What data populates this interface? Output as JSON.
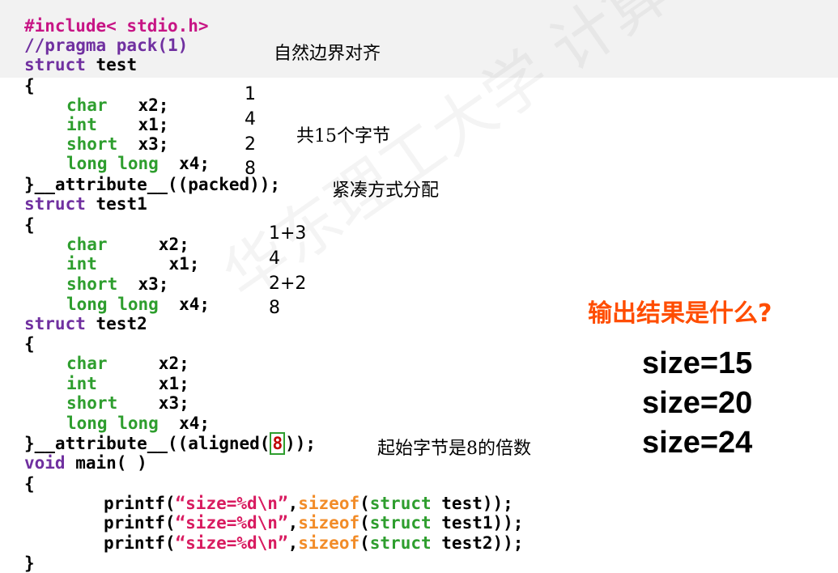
{
  "watermark": "华东理工大学 计算机系统 嵩天",
  "code": {
    "include": "#include< stdio.h>",
    "pragma": "//pragma pack(1)",
    "struct_kw": "struct",
    "name_test": "test",
    "name_test1": "test1",
    "name_test2": "test2",
    "open_brace": "{",
    "close_brace": "}",
    "t_char": "char",
    "t_int": "int",
    "t_short": "short",
    "t_long_long": "long long",
    "v_x2": "x2;",
    "v_x1": "x1;",
    "v_x3": "x3;",
    "v_x4": "x4;",
    "attr_packed": "}__attribute__((packed));",
    "attr_aligned_pre": "}__attribute__((aligned(",
    "attr_aligned_num": "8",
    "attr_aligned_post": "));",
    "void_kw": "void",
    "main_sig": "main( )",
    "printf_a": "printf(",
    "fmt": "“size=%d\\n”",
    "comma": ",",
    "sizeof_kw": "sizeof",
    "paren_open": "(",
    "end_1": "test));",
    "end_2": "test1));",
    "end_3": "test2));"
  },
  "notes": {
    "natural_align": "自然边界对齐",
    "total_15": "共15个字节",
    "packed_note": "紧凑方式分配",
    "aligned_note": "起始字节是8的倍数"
  },
  "sizes_test": [
    "1",
    "4",
    "2",
    "8"
  ],
  "sizes_test1": [
    "1+3",
    "4",
    "2+2",
    "8"
  ],
  "question": "输出结果是什么?",
  "results": [
    "size=15",
    "size=20",
    "size=24"
  ]
}
